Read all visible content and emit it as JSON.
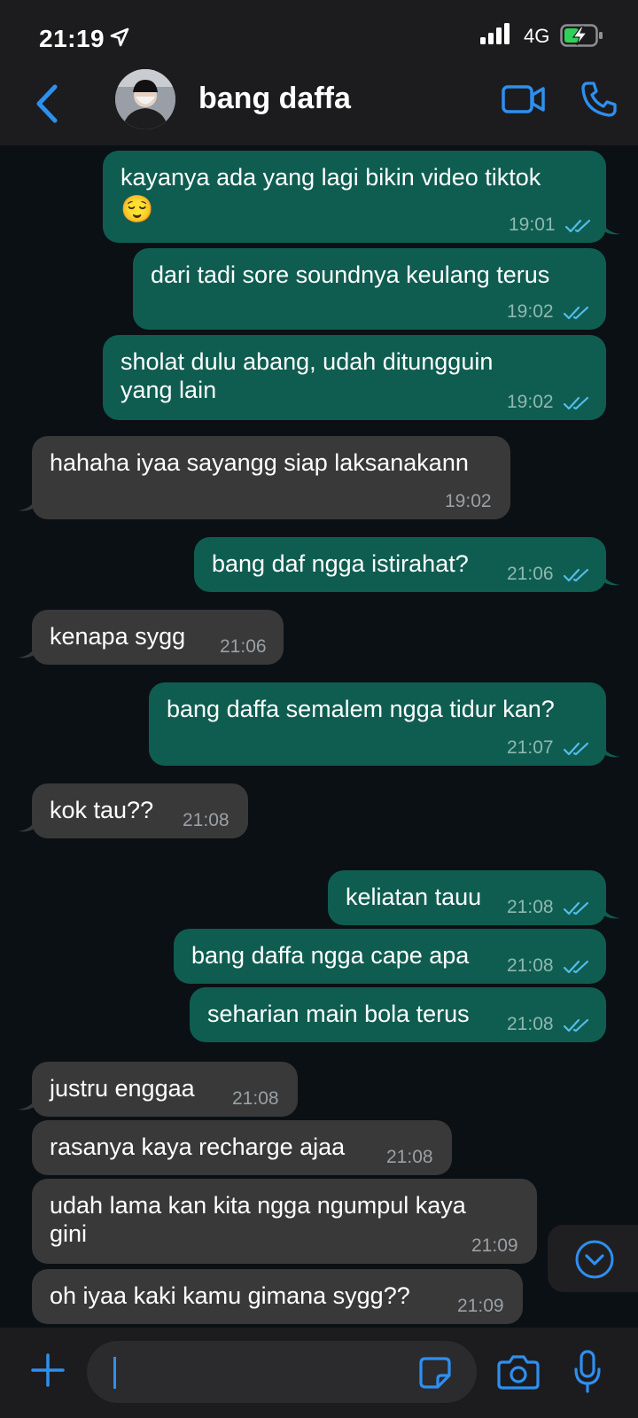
{
  "status": {
    "time": "21:19",
    "network": "4G"
  },
  "header": {
    "contact_name": "bang daffa"
  },
  "colors": {
    "accent": "#2e8ff0",
    "outgoing": "#0f5d51",
    "incoming": "#393939",
    "tick": "#53bdeb"
  },
  "messages": [
    {
      "dir": "out",
      "lines": [
        "kayanya ada yang lagi bikin video tiktok",
        "😌"
      ],
      "time": "19:01"
    },
    {
      "dir": "out",
      "lines": [
        "dari tadi sore soundnya keulang terus"
      ],
      "time": "19:02"
    },
    {
      "dir": "out",
      "lines": [
        "sholat dulu abang, udah ditungguin",
        "yang lain"
      ],
      "time": "19:02"
    },
    {
      "dir": "in",
      "lines": [
        "hahaha iyaa sayangg siap laksanakann"
      ],
      "time": "19:02"
    },
    {
      "dir": "out",
      "lines": [
        "bang daf ngga istirahat?"
      ],
      "time": "21:06"
    },
    {
      "dir": "in",
      "lines": [
        "kenapa sygg"
      ],
      "time": "21:06"
    },
    {
      "dir": "out",
      "lines": [
        "bang daffa semalem ngga tidur kan?"
      ],
      "time": "21:07"
    },
    {
      "dir": "in",
      "lines": [
        "kok tau??"
      ],
      "time": "21:08"
    },
    {
      "dir": "out",
      "lines": [
        "keliatan tauu"
      ],
      "time": "21:08"
    },
    {
      "dir": "out",
      "lines": [
        "bang daffa ngga cape apa"
      ],
      "time": "21:08"
    },
    {
      "dir": "out",
      "lines": [
        "seharian main bola terus"
      ],
      "time": "21:08"
    },
    {
      "dir": "in",
      "lines": [
        "justru enggaa"
      ],
      "time": "21:08"
    },
    {
      "dir": "in",
      "lines": [
        "rasanya kaya recharge ajaa"
      ],
      "time": "21:08"
    },
    {
      "dir": "in",
      "lines": [
        "udah lama kan kita ngga ngumpul kaya",
        "gini"
      ],
      "time": "21:09"
    },
    {
      "dir": "in",
      "lines": [
        "oh iyaa kaki kamu gimana sygg??"
      ],
      "time": "21:09"
    }
  ]
}
